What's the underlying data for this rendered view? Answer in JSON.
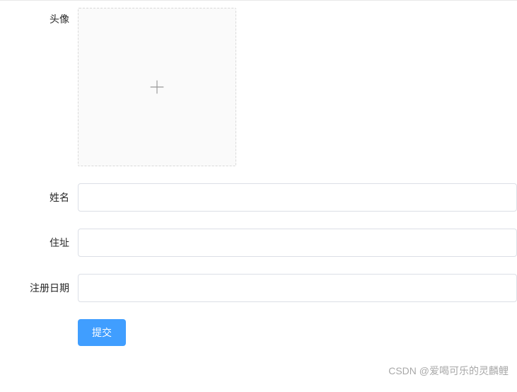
{
  "form": {
    "avatar": {
      "label": "头像"
    },
    "name": {
      "label": "姓名",
      "value": "",
      "placeholder": ""
    },
    "address": {
      "label": "住址",
      "value": "",
      "placeholder": ""
    },
    "registerDate": {
      "label": "注册日期",
      "value": "",
      "placeholder": ""
    },
    "submit": {
      "label": "提交"
    }
  },
  "watermark": "CSDN @爱喝可乐的灵麟鲤"
}
